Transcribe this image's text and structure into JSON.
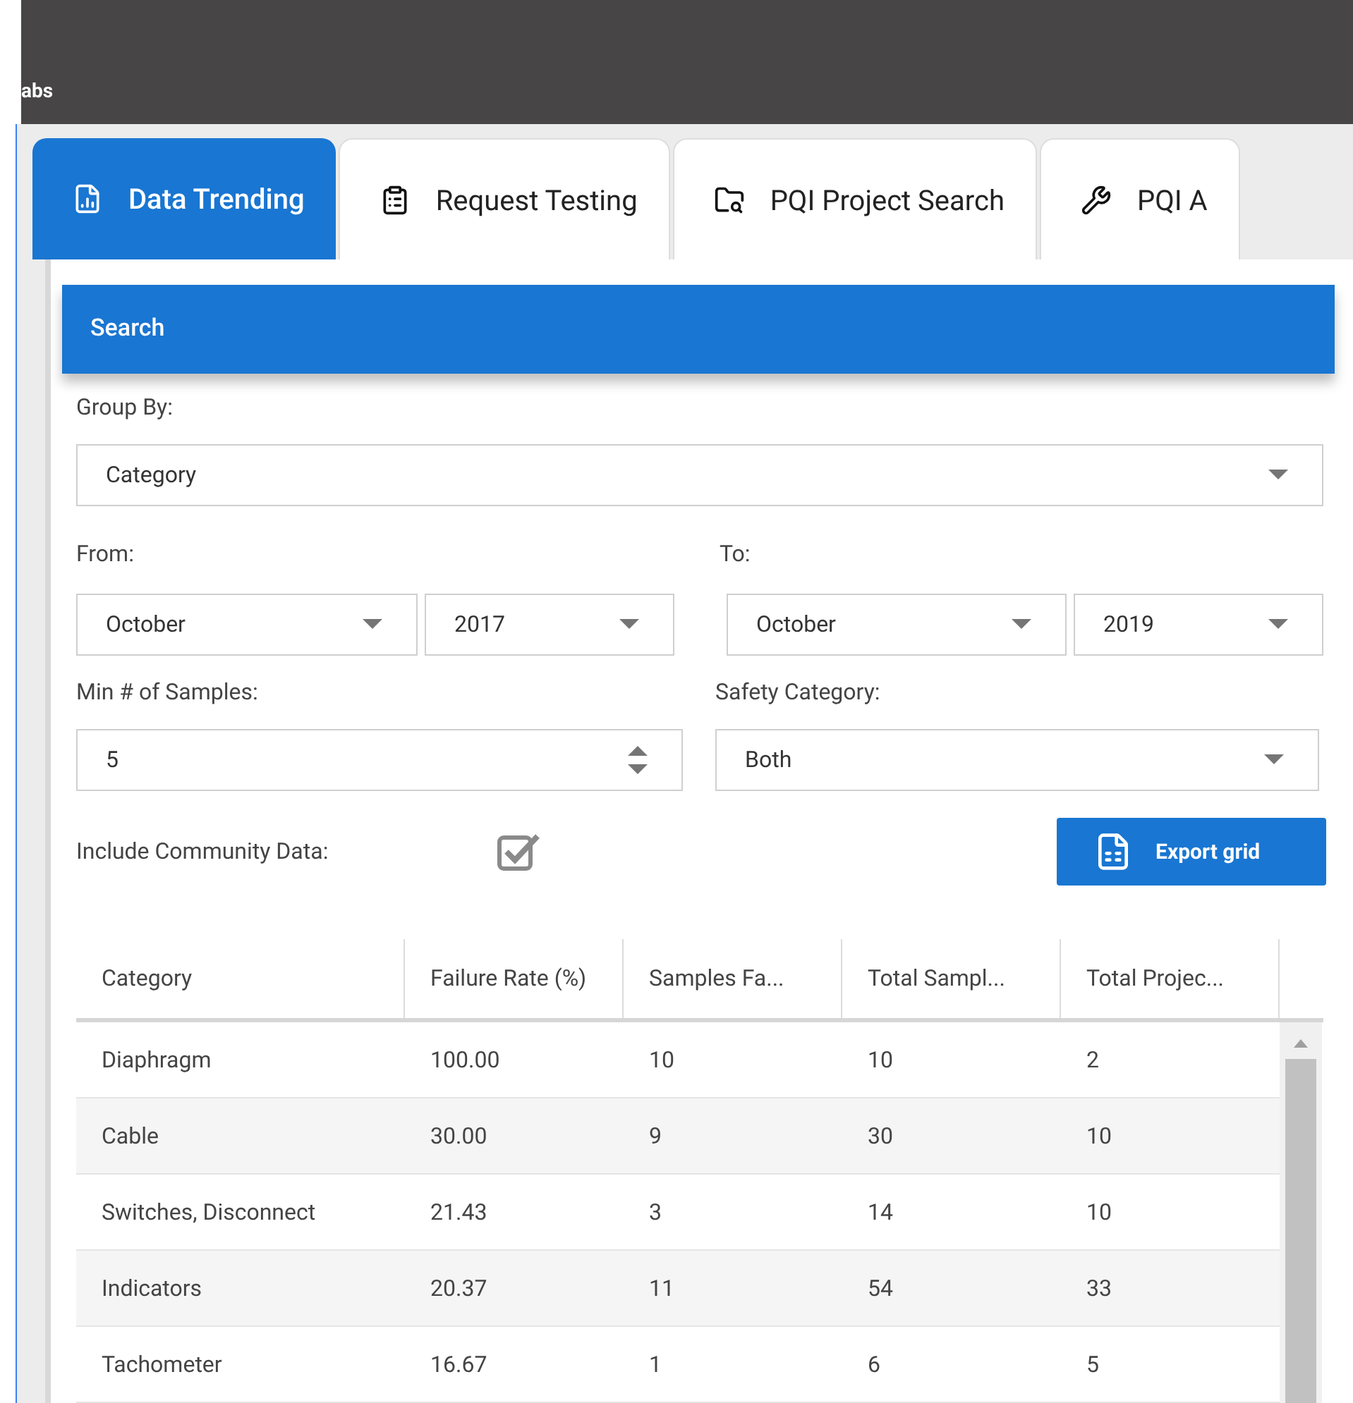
{
  "header": {
    "brand": "abs"
  },
  "tabs": [
    {
      "label": "Data Trending",
      "kind": "chart-document",
      "selected": true
    },
    {
      "label": "Request Testing",
      "kind": "clipboard",
      "selected": false
    },
    {
      "label": "PQI Project Search",
      "kind": "folder-search",
      "selected": false
    },
    {
      "label": "PQI A",
      "kind": "wrench",
      "selected": false
    }
  ],
  "search": {
    "title": "Search",
    "group_by": {
      "label": "Group By:",
      "value": "Category"
    },
    "from": {
      "label": "From:",
      "month": "October",
      "year": "2017"
    },
    "to": {
      "label": "To:",
      "month": "October",
      "year": "2019"
    },
    "min_samples": {
      "label": "Min # of Samples:",
      "value": "5"
    },
    "safety_category": {
      "label": "Safety Category:",
      "value": "Both"
    },
    "include_community": {
      "label": "Include Community Data:",
      "checked": true
    },
    "export_button": "Export grid"
  },
  "table": {
    "columns": [
      "Category",
      "Failure Rate (%)",
      "Samples Fa...",
      "Total Sampl...",
      "Total Projec..."
    ],
    "rows": [
      [
        "Diaphragm",
        "100.00",
        "10",
        "10",
        "2"
      ],
      [
        "Cable",
        "30.00",
        "9",
        "30",
        "10"
      ],
      [
        "Switches, Disconnect",
        "21.43",
        "3",
        "14",
        "10"
      ],
      [
        "Indicators",
        "20.37",
        "11",
        "54",
        "33"
      ],
      [
        "Tachometer",
        "16.67",
        "1",
        "6",
        "5"
      ]
    ]
  }
}
